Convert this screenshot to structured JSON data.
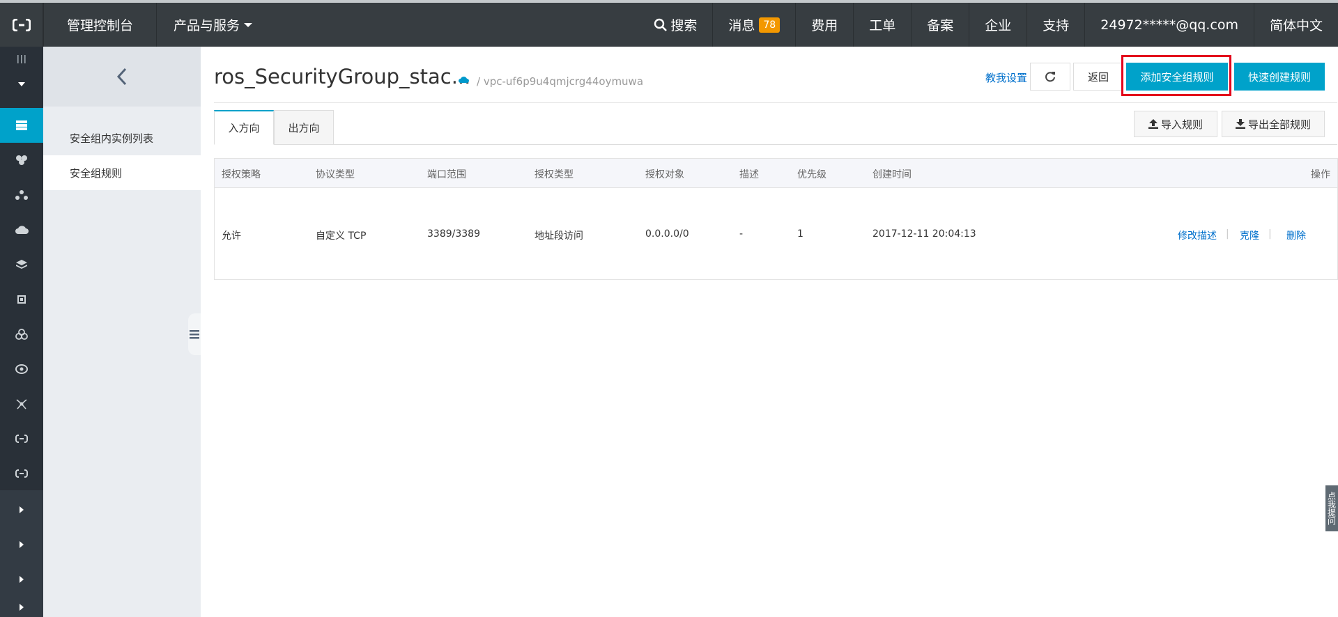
{
  "topnav": {
    "console": "管理控制台",
    "products": "产品与服务",
    "search": "搜索",
    "messages": "消息",
    "messages_count": "78",
    "fees": "费用",
    "tickets": "工单",
    "filing": "备案",
    "enterprise": "企业",
    "support": "支持",
    "account": "24972*****@qq.com",
    "language": "简体中文"
  },
  "sidebar": {
    "items": [
      {
        "label": "安全组内实例列表"
      },
      {
        "label": "安全组规则"
      }
    ]
  },
  "header": {
    "title": "ros_SecurityGroup_stac...",
    "vpc": "/ vpc-uf6p9u4qmjcrg44oymuwa",
    "help": "教我设置",
    "back": "返回",
    "add_rule": "添加安全组规则",
    "quick_create": "快速创建规则"
  },
  "tabs": {
    "inbound": "入方向",
    "outbound": "出方向"
  },
  "actions": {
    "import": "导入规则",
    "export": "导出全部规则"
  },
  "table": {
    "columns": [
      "授权策略",
      "协议类型",
      "端口范围",
      "授权类型",
      "授权对象",
      "描述",
      "优先级",
      "创建时间",
      "操作"
    ],
    "rows": [
      {
        "policy": "允许",
        "protocol": "自定义 TCP",
        "port": "3389/3389",
        "auth_type": "地址段访问",
        "auth_object": "0.0.0.0/0",
        "desc": "-",
        "priority": "1",
        "created": "2017-12-11 20:04:13",
        "ops": [
          "修改描述",
          "克隆",
          "删除"
        ]
      }
    ]
  },
  "float_help": "点我提问",
  "colors": {
    "topnav_bg": "#373d41",
    "accent": "#00a2ca",
    "link": "#0070cc",
    "badge": "#f39800",
    "highlight": "#e3001b"
  }
}
